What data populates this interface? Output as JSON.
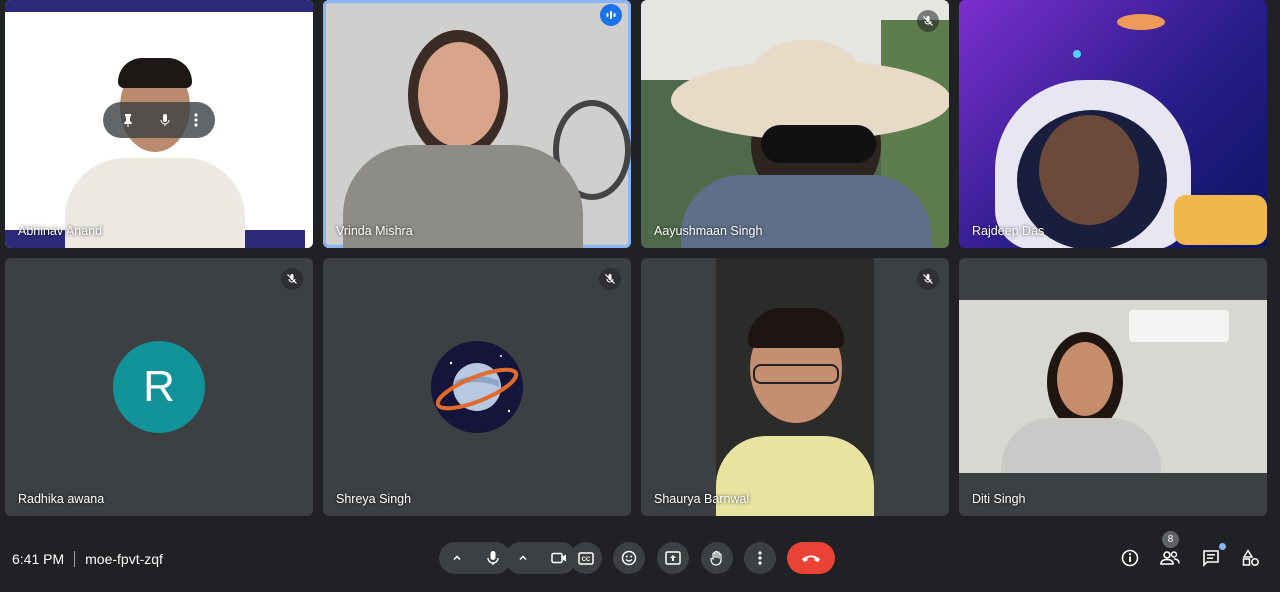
{
  "meeting": {
    "time": "6:41 PM",
    "code": "moe-fpvt-zqf"
  },
  "participants": [
    {
      "name": "Abhinav Anand"
    },
    {
      "name": "Vrinda Mishra"
    },
    {
      "name": "Aayushmaan Singh"
    },
    {
      "name": "Rajdeep Das"
    },
    {
      "name": "Radhika awana",
      "initial": "R"
    },
    {
      "name": "Shreya Singh"
    },
    {
      "name": "Shaurya Barnwal"
    },
    {
      "name": "Diti Singh"
    }
  ],
  "people_count": "8",
  "colors": {
    "background": "#202124",
    "tile": "#3c4043",
    "end_call": "#ea4335",
    "avatar_teal": "#12939a",
    "active_outline": "#8ab4f8"
  }
}
